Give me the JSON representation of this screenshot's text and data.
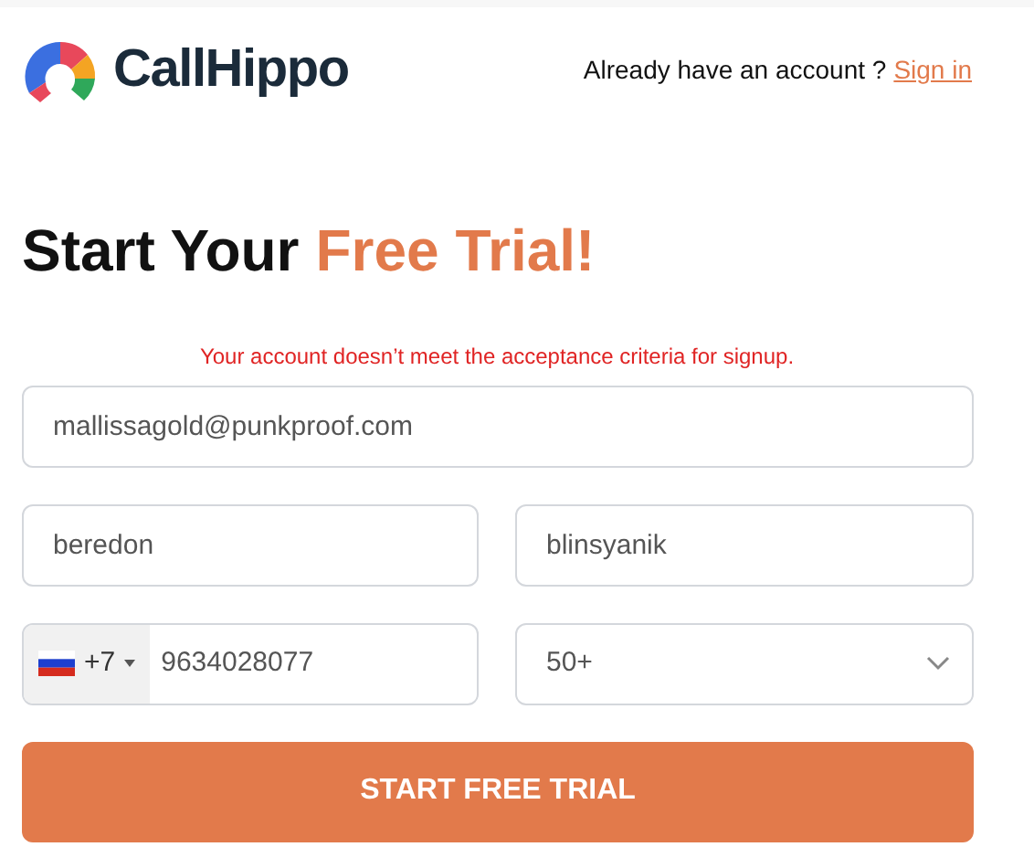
{
  "header": {
    "brand": "CallHippo",
    "prompt": "Already have an account ?",
    "sign_in_link": "Sign in"
  },
  "heading": {
    "text": "Start Your",
    "highlight": "Free Trial!"
  },
  "error": "Your account doesn’t meet the acceptance criteria for signup.",
  "form": {
    "email": {
      "value": "mallissagold@punkproof.com"
    },
    "first_name": {
      "value": "beredon"
    },
    "last_name": {
      "value": "blinsyanik"
    },
    "phone": {
      "dial_code": "+7",
      "value": "9634028077"
    },
    "team_size": {
      "value": "50+"
    },
    "submit": "START FREE TRIAL"
  }
}
